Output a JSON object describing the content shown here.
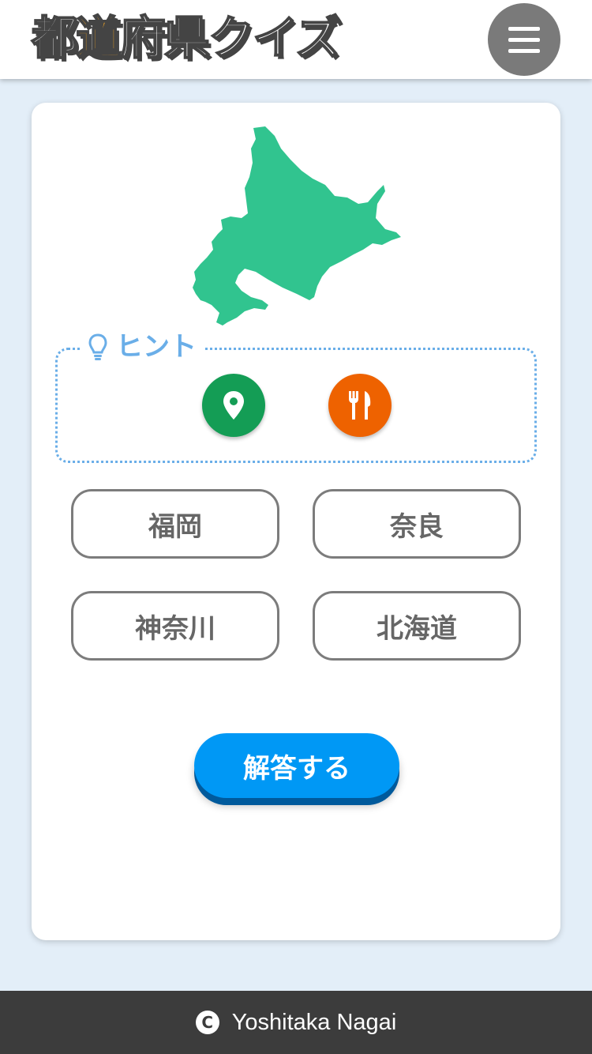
{
  "header": {
    "logo_part1": "都",
    "logo_accent": "道",
    "logo_part2": "府県クイズ",
    "menu_icon": "hamburger-menu-icon"
  },
  "quiz": {
    "map_region_icon": "hokkaido-map",
    "hint": {
      "icon": "lightbulb-icon",
      "label": "ヒント",
      "buttons": [
        {
          "icon": "location-pin-icon",
          "color": "#149d55"
        },
        {
          "icon": "fork-knife-icon",
          "color": "#ee6200"
        }
      ]
    },
    "choices": [
      "福岡",
      "奈良",
      "神奈川",
      "北海道"
    ],
    "submit_label": "解答する"
  },
  "footer": {
    "copyright_symbol": "C",
    "author": "Yoshitaka Nagai"
  },
  "colors": {
    "page_bg": "#e3eef8",
    "map_fill": "#31c48f",
    "hint_accent": "#6aaee8",
    "submit_bg": "#0098f5",
    "logo_accent": "#f5a623"
  }
}
